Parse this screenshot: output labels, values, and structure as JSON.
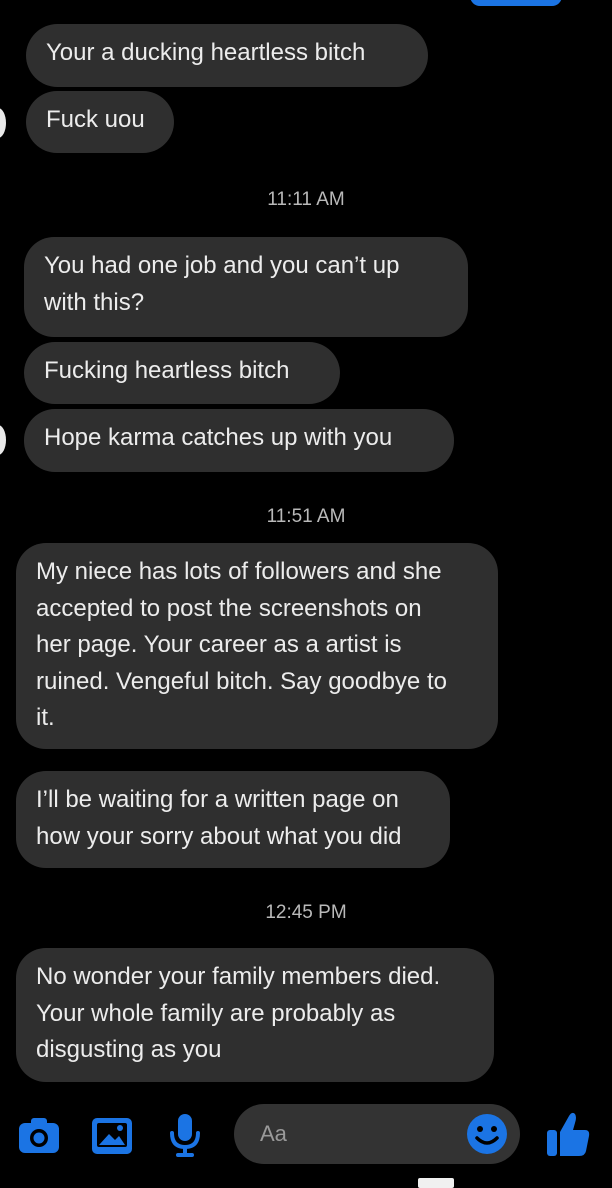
{
  "messages": [
    {
      "text": "Your a ducking heartless bitch"
    },
    {
      "text": "Fuck uou"
    },
    {
      "timestamp": "11:11 AM"
    },
    {
      "text": "You had one job and you can’t up\nwith this?"
    },
    {
      "text": "Fucking heartless bitch"
    },
    {
      "text": "Hope karma catches up with you"
    },
    {
      "timestamp": "11:51 AM"
    },
    {
      "text": "My niece has lots of followers and she\naccepted to post the screenshots on\nher page. Your career as a artist is\nruined. Vengeful bitch. Say goodbye to\nit."
    },
    {
      "text": "I’ll be waiting for a written page on\nhow your sorry about what you did"
    },
    {
      "timestamp": "12:45 PM"
    },
    {
      "text": "No wonder your family members died.\nYour whole family are probably as\ndisgusting as you"
    }
  ],
  "composer": {
    "placeholder": "Aa",
    "icons": [
      "camera-icon",
      "image-icon",
      "microphone-icon",
      "emoji-icon",
      "thumbs-up-icon"
    ],
    "accent": "#1b74e4"
  },
  "colors": {
    "background": "#000000",
    "bubble": "#2f2f2f",
    "text": "#ececec",
    "timestamp": "#b9b9b9"
  }
}
